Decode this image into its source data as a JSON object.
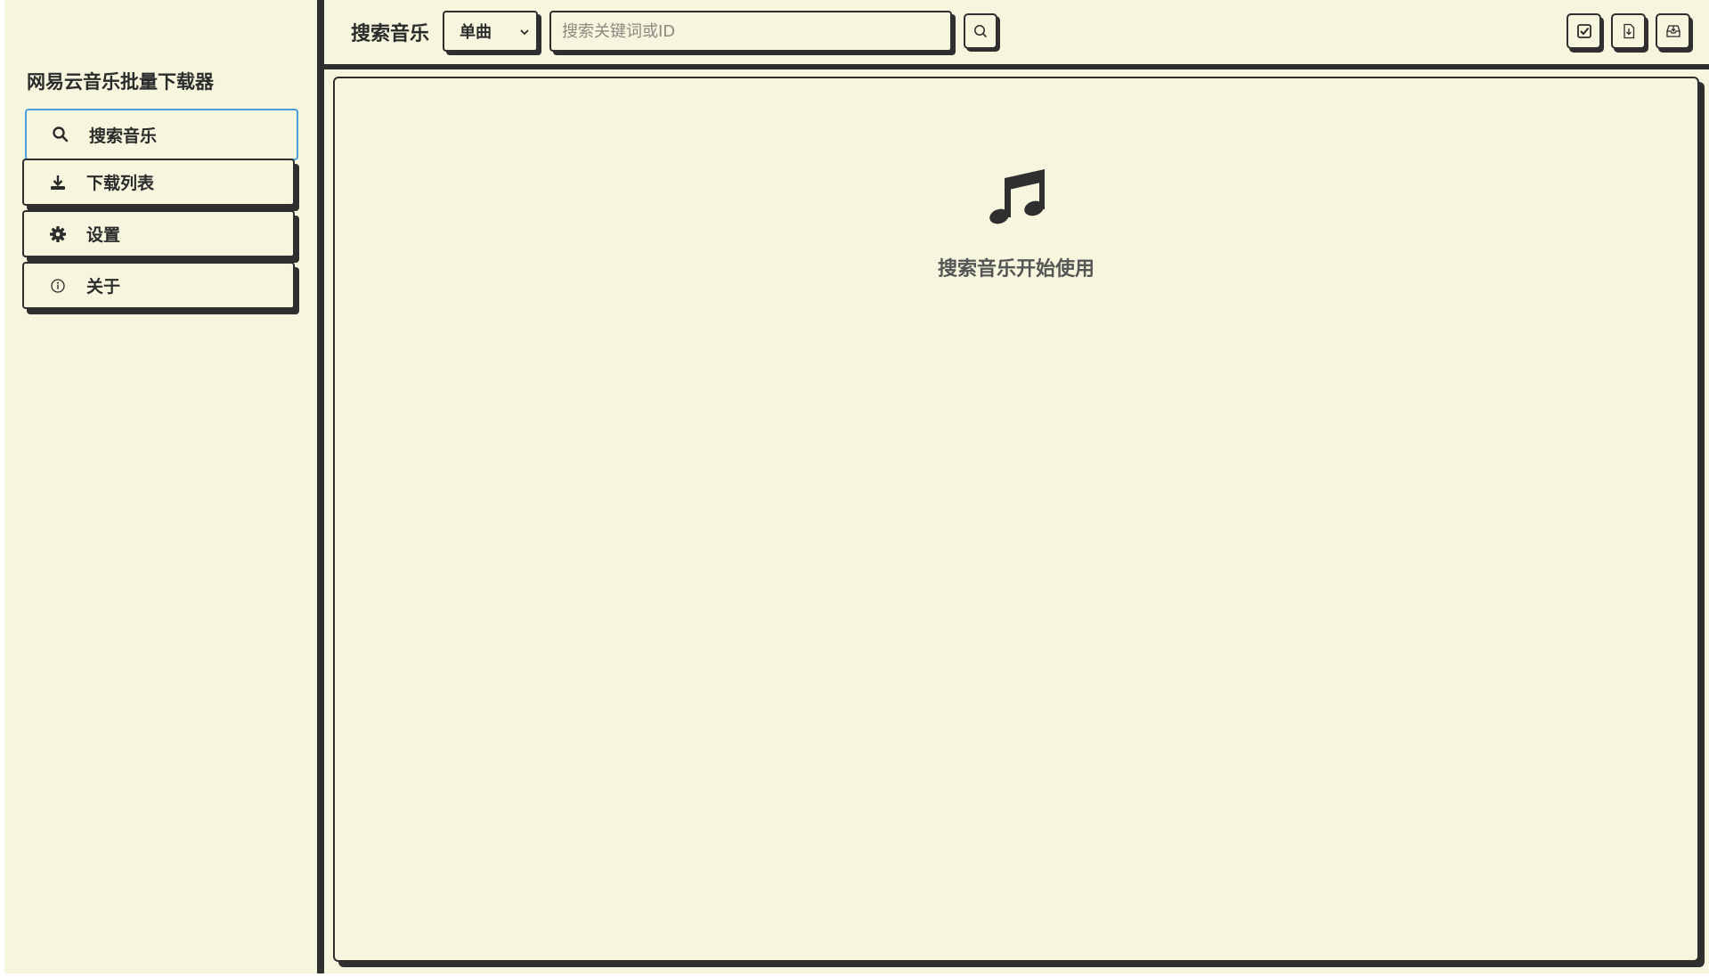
{
  "app": {
    "title": "网易云音乐批量下载器"
  },
  "sidebar": {
    "items": [
      {
        "label": "搜索音乐",
        "icon": "search-icon",
        "active": true
      },
      {
        "label": "下载列表",
        "icon": "download-icon",
        "active": false
      },
      {
        "label": "设置",
        "icon": "gear-icon",
        "active": false
      },
      {
        "label": "关于",
        "icon": "info-icon",
        "active": false
      }
    ]
  },
  "header": {
    "page_title": "搜索音乐",
    "type_select": {
      "selected": "单曲"
    },
    "search": {
      "placeholder": "搜索关键词或ID",
      "value": ""
    },
    "search_button_icon": "search-icon",
    "toolbar_icons": [
      "check-square-icon",
      "file-download-icon",
      "inbox-download-icon"
    ]
  },
  "main": {
    "empty_icon": "music-note-icon",
    "empty_message": "搜索音乐开始使用"
  },
  "colors": {
    "background": "#f6f6de",
    "border": "#2f2f2f",
    "active_border": "#4a9fd8",
    "text": "#2b2b2b",
    "muted_text": "#555555"
  }
}
